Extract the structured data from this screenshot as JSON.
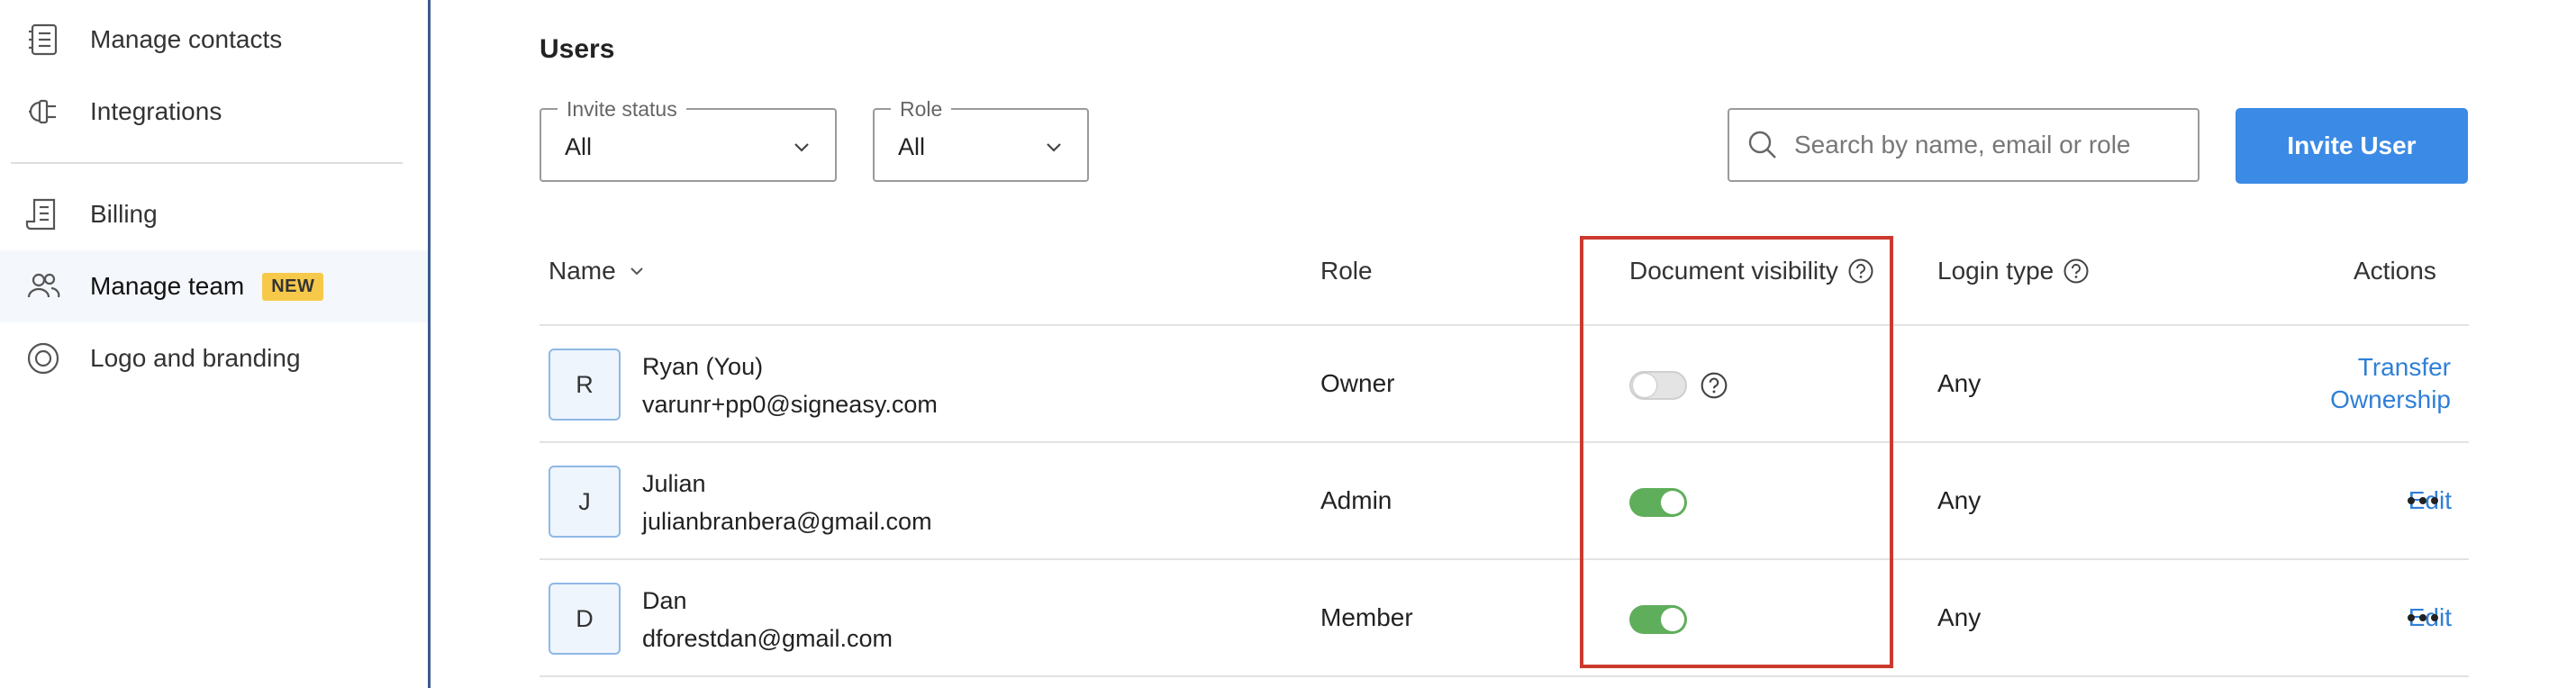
{
  "sidebar": {
    "items": [
      {
        "label": "Manage contacts",
        "icon": "contacts-list-icon"
      },
      {
        "label": "Integrations",
        "icon": "plug-icon"
      },
      {
        "label": "Billing",
        "icon": "receipt-icon"
      },
      {
        "label": "Manage team",
        "icon": "team-icon",
        "badge": "NEW",
        "active": true
      },
      {
        "label": "Logo and branding",
        "icon": "target-circle-icon"
      }
    ]
  },
  "main": {
    "title": "Users",
    "filters": {
      "invite_status": {
        "label": "Invite status",
        "value": "All"
      },
      "role": {
        "label": "Role",
        "value": "All"
      }
    },
    "search": {
      "placeholder": "Search by name, email or role"
    },
    "invite_button": "Invite User"
  },
  "table": {
    "headers": {
      "name": "Name",
      "role": "Role",
      "document_visibility": "Document visibility",
      "login_type": "Login type",
      "actions": "Actions"
    },
    "rows": [
      {
        "initial": "R",
        "name": "Ryan (You)",
        "email": "varunr+pp0@signeasy.com",
        "role": "Owner",
        "visibility": false,
        "login_type": "Any",
        "action_line1": "Transfer",
        "action_line2": "Ownership"
      },
      {
        "initial": "J",
        "name": "Julian",
        "email": "julianbranbera@gmail.com",
        "role": "Admin",
        "visibility": true,
        "login_type": "Any",
        "action": "Edit"
      },
      {
        "initial": "D",
        "name": "Dan",
        "email": "dforestdan@gmail.com",
        "role": "Member",
        "visibility": true,
        "login_type": "Any",
        "action": "Edit"
      }
    ]
  },
  "colors": {
    "accent": "#3b8ae6",
    "link": "#2f7fd6",
    "toggle_on": "#5fae5b",
    "badge": "#f7c94b",
    "highlight": "#cc3a2e"
  }
}
